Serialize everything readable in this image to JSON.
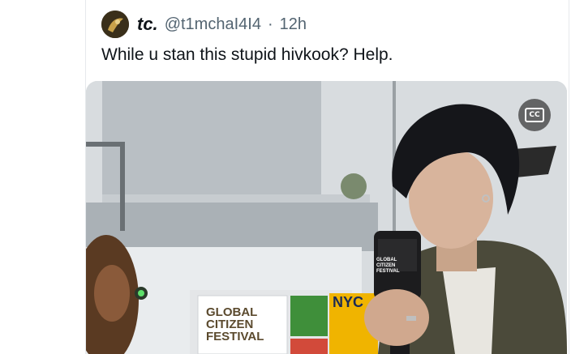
{
  "tweet": {
    "display_name": "tc.",
    "handle": "@t1mchaI4I4",
    "separator": "·",
    "time": "12h",
    "text": "While u stan this stupid hivkook? Help."
  },
  "media": {
    "cc_label": "CC",
    "banner_lines": [
      "GLOBAL",
      "CITIZEN",
      "FESTIVAL"
    ],
    "nyc_text": "NYC",
    "mic_flag_text": "GLOBAL CITIZEN FESTIVAL"
  },
  "icons": {
    "avatar": "avatar-icon",
    "closed_captions": "cc-icon"
  }
}
